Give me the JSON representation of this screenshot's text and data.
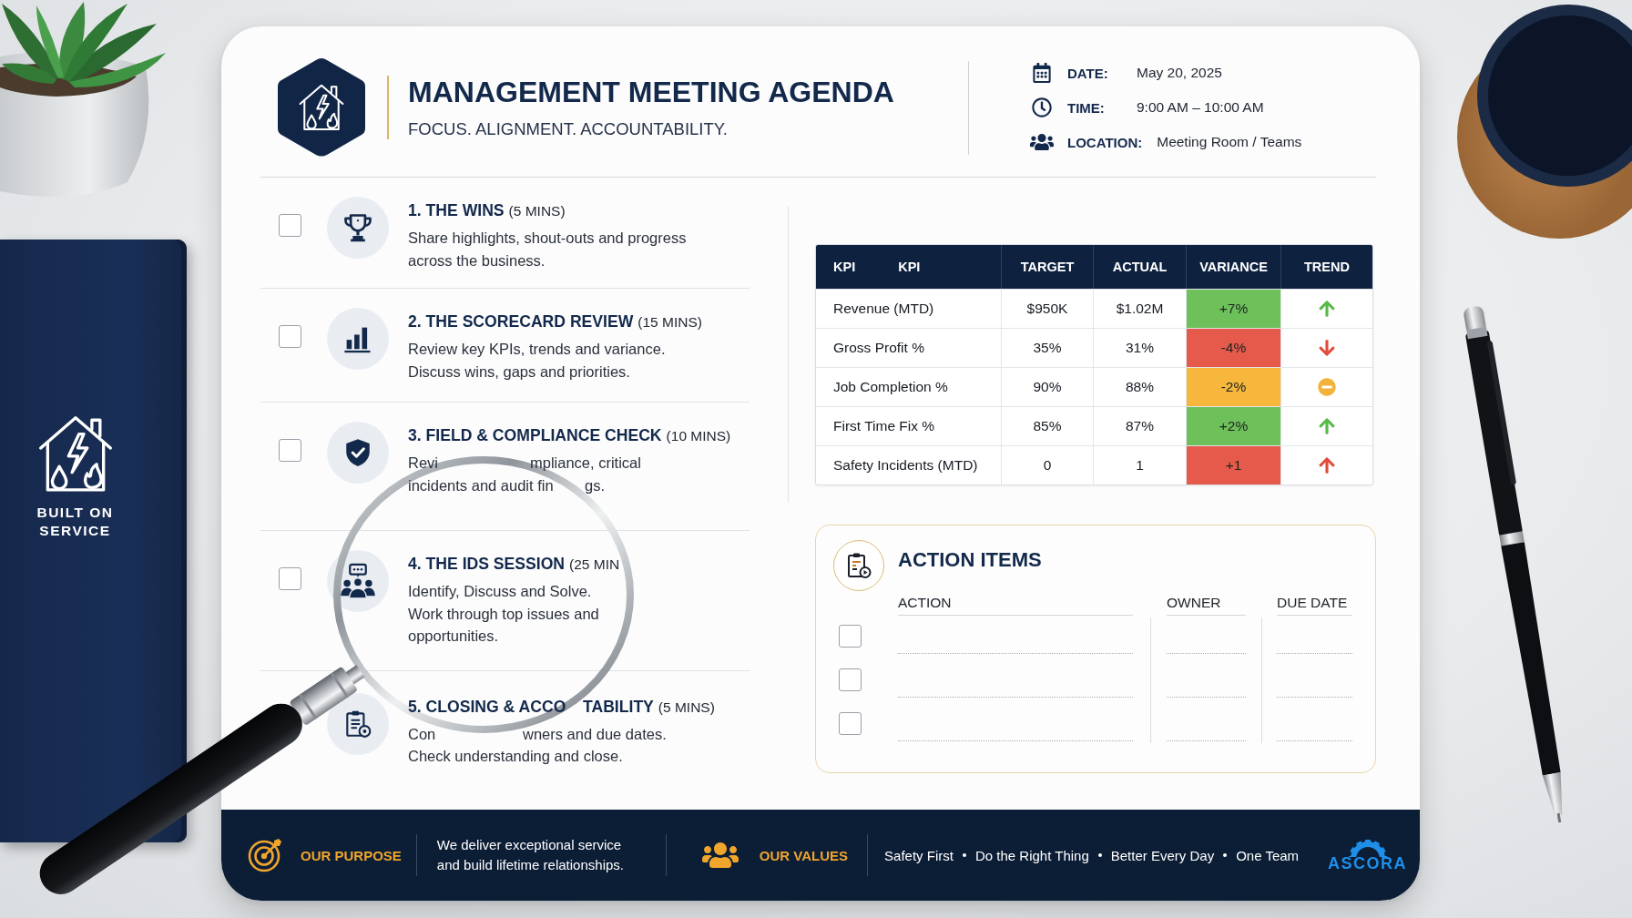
{
  "notebook": {
    "label": "BUILT ON SERVICE"
  },
  "header": {
    "title": "MANAGEMENT MEETING AGENDA",
    "tagline": "FOCUS. ALIGNMENT. ACCOUNTABILITY.",
    "meta": [
      {
        "kind": "date",
        "label": "DATE:",
        "value": "May 20, 2025"
      },
      {
        "kind": "time",
        "label": "TIME:",
        "value": "9:00 AM – 10:00 AM"
      },
      {
        "kind": "location",
        "label": "LOCATION:",
        "value": "Meeting Room / Teams"
      }
    ]
  },
  "agenda": [
    {
      "kind": "trophy",
      "checked": false,
      "title": [
        "1. THE WINS"
      ],
      "duration": "(5 MINS)",
      "lines": [
        [
          "Share highlights, shout-outs and progress"
        ],
        [
          "across the business."
        ]
      ]
    },
    {
      "kind": "chart",
      "checked": false,
      "title": [
        "2. THE SCORECARD REVIEW"
      ],
      "duration": "(15 MINS)",
      "lines": [
        [
          "Review key KPIs, trends and variance."
        ],
        [
          "Discuss wins, gaps and priorities."
        ]
      ]
    },
    {
      "kind": "shield",
      "checked": false,
      "title": [
        "3. FIELD & COMPLIANCE CHECK"
      ],
      "duration": "(10 MINS)",
      "lines": [
        [
          "Revi",
          "mpliance, critical"
        ],
        [
          "incidents and audit fin",
          "gs."
        ]
      ]
    },
    {
      "kind": "discussion",
      "checked": false,
      "title": [
        "4. THE IDS SESSION"
      ],
      "duration": "(25 MIN",
      "lines": [
        [
          "Identify, Discuss and Solve."
        ],
        [
          "Work through top issues and"
        ],
        [
          "opportunities."
        ]
      ]
    },
    {
      "kind": "clipboard",
      "title": [
        "5. CLOSING & ACCO",
        "TABILITY"
      ],
      "duration": "(5 MINS)",
      "lines": [
        [
          "Con",
          "wners and due dates."
        ],
        [
          "Check understanding and close."
        ]
      ]
    }
  ],
  "kpi_table": {
    "columns": [
      [
        "KPI",
        "KPI"
      ],
      [
        "TARGET"
      ],
      [
        "ACTUAL"
      ],
      [
        "VARIANCE"
      ],
      [
        "TREND"
      ]
    ],
    "rows": [
      {
        "kpi": "Revenue (MTD)",
        "target": "$950K",
        "actual": "$1.02M",
        "variance": {
          "text": "+7%",
          "color": "#6dc05a"
        },
        "trend": {
          "kind": "up",
          "color": "#57b947"
        }
      },
      {
        "kpi": "Gross Profit %",
        "target": "35%",
        "actual": "31%",
        "variance": {
          "text": "-4%",
          "color": "#e65a4b"
        },
        "trend": {
          "kind": "down",
          "color": "#e14b3b"
        }
      },
      {
        "kpi": "Job Completion %",
        "target": "90%",
        "actual": "88%",
        "variance": {
          "text": "-2%",
          "color": "#f6b73c"
        },
        "trend": {
          "kind": "flat",
          "color": "#f3b23a"
        }
      },
      {
        "kpi": "First Time Fix %",
        "target": "85%",
        "actual": "87%",
        "variance": {
          "text": "+2%",
          "color": "#6dc05a"
        },
        "trend": {
          "kind": "up",
          "color": "#57b947"
        }
      },
      {
        "kpi": "Safety Incidents (MTD)",
        "target": "0",
        "actual": "1",
        "variance": {
          "text": "+1",
          "color": "#e65a4b"
        },
        "trend": {
          "kind": "up",
          "color": "#e14b3b"
        }
      }
    ]
  },
  "action_items": {
    "title": "ACTION ITEMS",
    "columns": [
      "ACTION",
      "OWNER",
      "DUE DATE"
    ],
    "rows": [
      {
        "checked": false
      },
      {
        "checked": false
      },
      {
        "checked": false
      }
    ]
  },
  "footer": {
    "purpose_label": "OUR PURPOSE",
    "purpose": "We deliver exceptional service and build lifetime relationships.",
    "values_label": "OUR VALUES",
    "values": [
      "Safety First",
      "Do the Right Thing",
      "Better Every Day",
      "One Team"
    ],
    "logo": "ASCORA"
  }
}
